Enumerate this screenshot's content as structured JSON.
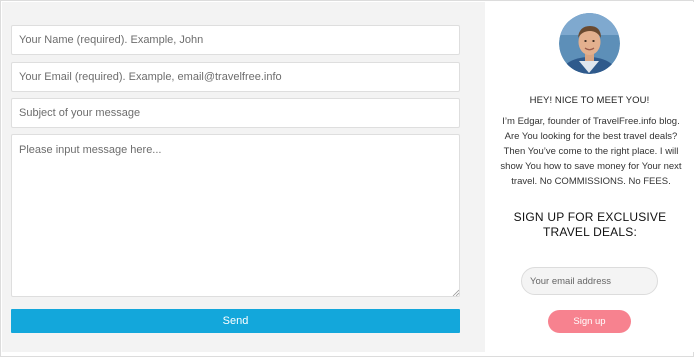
{
  "contact_form": {
    "name_placeholder": "Your Name (required). Example, John",
    "email_placeholder": "Your Email (required). Example, email@travelfree.info",
    "subject_placeholder": "Subject of your message",
    "message_placeholder": "Please input message here...",
    "send_label": "Send"
  },
  "profile": {
    "avatar_icon": "author-photo",
    "greeting": "HEY! NICE TO MEET YOU!",
    "about": "I’m Edgar, founder of TravelFree.info blog. Are You looking for the best travel deals? Then You’ve come to the right place. I will show You how to save money for Your next travel. No COMMISSIONS. No FEES."
  },
  "signup": {
    "heading": "SIGN UP FOR EXCLUSIVE TRAVEL DEALS:",
    "email_placeholder": "Your email address",
    "button_label": "Sign up"
  },
  "colors": {
    "send_button": "#13a7db",
    "signup_button": "#f7828f",
    "form_background": "#f3f3f3"
  }
}
